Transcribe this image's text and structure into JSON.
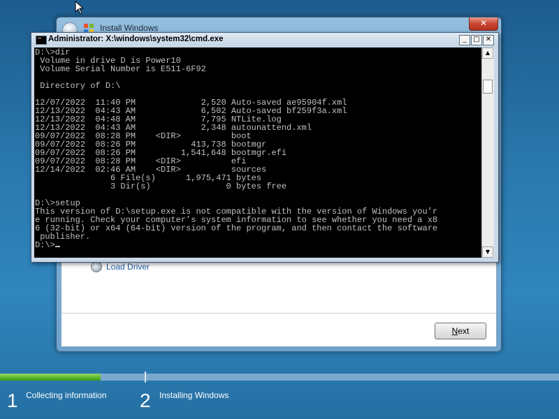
{
  "installer": {
    "title": "Install Windows",
    "close_label": "✕",
    "load_driver_label": "Load Driver",
    "next_label_prefix": "N",
    "next_label_rest": "ext"
  },
  "cmd": {
    "title": "Administrator: X:\\windows\\system32\\cmd.exe",
    "min_label": "_",
    "max_label": "□",
    "close_label": "✕",
    "prompt": "D:\\>",
    "lines": [
      "D:\\>dir",
      " Volume in drive D is Power10",
      " Volume Serial Number is E511-6F92",
      "",
      " Directory of D:\\",
      "",
      "12/07/2022  11:40 PM             2,520 Auto-saved ae95904f.xml",
      "12/13/2022  04:43 AM             6,502 Auto-saved bf259f3a.xml",
      "12/13/2022  04:48 AM             7,795 NTLite.log",
      "12/13/2022  04:43 AM             2,348 autounattend.xml",
      "09/07/2022  08:28 PM    <DIR>          boot",
      "09/07/2022  08:26 PM           413,738 bootmgr",
      "09/07/2022  08:26 PM         1,541,648 bootmgr.efi",
      "09/07/2022  08:28 PM    <DIR>          efi",
      "12/14/2022  02:46 AM    <DIR>          sources",
      "               6 File(s)      1,975,471 bytes",
      "               3 Dir(s)               0 bytes free",
      "",
      "D:\\>setup",
      "This version of D:\\setup.exe is not compatible with the version of Windows you’r",
      "e running. Check your computer’s system information to see whether you need a x8",
      "6 (32-bit) or x64 (64-bit) version of the program, and then contact the software",
      " publisher.",
      ""
    ]
  },
  "progress": {
    "fraction": 0.18,
    "steps": [
      {
        "number": "1",
        "label": "Collecting information"
      },
      {
        "number": "2",
        "label": "Installing Windows"
      }
    ]
  },
  "colors": {
    "console_bg": "#000000",
    "console_fg": "#c0c0c0",
    "progress_green": "#57b627"
  }
}
